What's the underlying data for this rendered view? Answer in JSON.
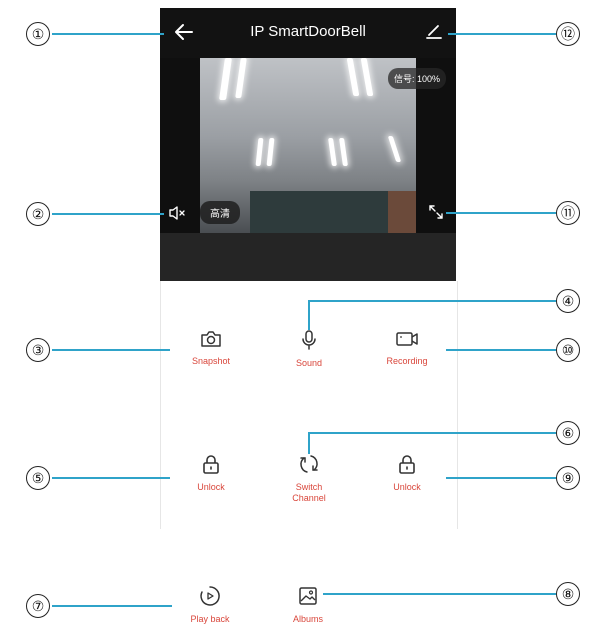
{
  "header": {
    "title": "IP SmartDoorBell",
    "back_icon": "arrow-left-icon",
    "edit_icon": "pencil-icon"
  },
  "video": {
    "signal": "信号: 100%",
    "quality": "高清",
    "mute_icon": "speaker-mute-icon",
    "fullscreen_icon": "fullscreen-icon"
  },
  "controls": {
    "snapshot": "Snapshot",
    "sound": "Sound",
    "recording": "Recording",
    "unlock_left": "Unlock",
    "switch_channel": "Switch Channel",
    "unlock_right": "Unlock",
    "playback": "Play back",
    "albums": "Albums"
  },
  "callouts": {
    "n1": "①",
    "n2": "②",
    "n3": "③",
    "n4": "④",
    "n5": "⑤",
    "n6": "⑥",
    "n7": "⑦",
    "n8": "⑧",
    "n9": "⑨",
    "n10": "⑩",
    "n11": "⑪",
    "n12": "⑫"
  },
  "colors": {
    "accent": "#d9463b",
    "callout_line": "#2fa3c9",
    "topbar": "#121212"
  }
}
